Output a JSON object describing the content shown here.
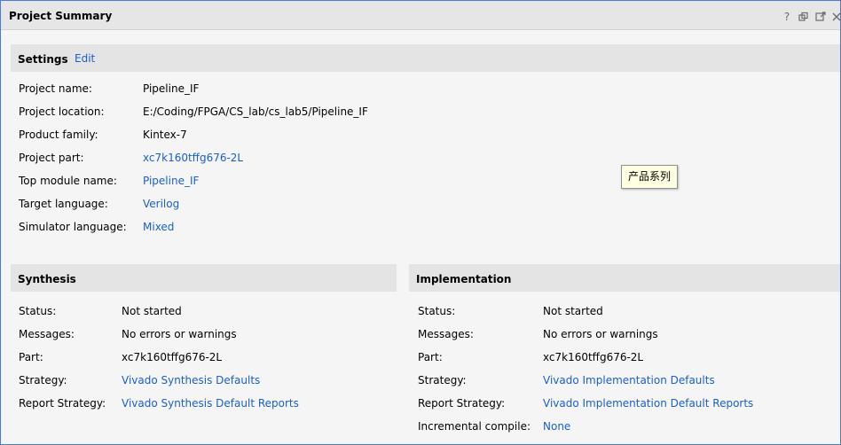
{
  "window": {
    "title": "Project Summary"
  },
  "titlebar_icons": [
    "help-icon",
    "restore-icon",
    "float-icon",
    "close-icon"
  ],
  "settings": {
    "heading": "Settings",
    "edit_label": "Edit",
    "rows": [
      {
        "label": "Project name:",
        "value": "Pipeline_IF",
        "link": false
      },
      {
        "label": "Project location:",
        "value": "E:/Coding/FPGA/CS_lab/cs_lab5/Pipeline_IF",
        "link": false
      },
      {
        "label": "Product family:",
        "value": "Kintex-7",
        "link": false
      },
      {
        "label": "Project part:",
        "value": "xc7k160tffg676-2L",
        "link": true
      },
      {
        "label": "Top module name:",
        "value": "Pipeline_IF",
        "link": true
      },
      {
        "label": "Target language:",
        "value": "Verilog",
        "link": true
      },
      {
        "label": "Simulator language:",
        "value": "Mixed",
        "link": true
      }
    ]
  },
  "tooltip": "产品系列",
  "synthesis": {
    "heading": "Synthesis",
    "rows": [
      {
        "label": "Status:",
        "value": "Not started",
        "link": false
      },
      {
        "label": "Messages:",
        "value": "No errors or warnings",
        "link": false
      },
      {
        "label": "Part:",
        "value": "xc7k160tffg676-2L",
        "link": false
      },
      {
        "label": "Strategy:",
        "value": "Vivado Synthesis Defaults",
        "link": true
      },
      {
        "label": "Report Strategy:",
        "value": "Vivado Synthesis Default Reports",
        "link": true
      }
    ]
  },
  "implementation": {
    "heading": "Implementation",
    "rows": [
      {
        "label": "Status:",
        "value": "Not started",
        "link": false
      },
      {
        "label": "Messages:",
        "value": "No errors or warnings",
        "link": false
      },
      {
        "label": "Part:",
        "value": "xc7k160tffg676-2L",
        "link": false
      },
      {
        "label": "Strategy:",
        "value": "Vivado Implementation Defaults",
        "link": true
      },
      {
        "label": "Report Strategy:",
        "value": "Vivado Implementation Default Reports",
        "link": true
      },
      {
        "label": "Incremental compile:",
        "value": "None",
        "link": true
      }
    ]
  },
  "colors": {
    "link": "#1c5fc8",
    "header_bg": "#e4e4e4",
    "panel_bg": "#f5f5f5",
    "border": "#4a7bd6"
  }
}
